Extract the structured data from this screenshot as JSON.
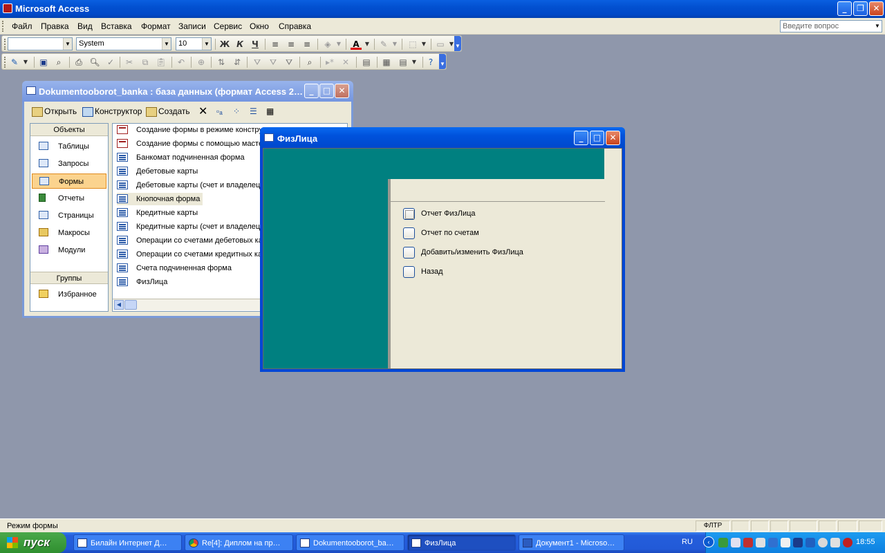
{
  "app": {
    "title": "Microsoft Access"
  },
  "menu": [
    {
      "label": "Файл"
    },
    {
      "label": "Правка"
    },
    {
      "label": "Вид"
    },
    {
      "label": "Вставка"
    },
    {
      "label": "Формат"
    },
    {
      "label": "Записи"
    },
    {
      "label": "Сервис"
    },
    {
      "label": "Окно"
    },
    {
      "label": "Справка"
    }
  ],
  "help_box": {
    "placeholder": "Введите вопрос"
  },
  "format_toolbar": {
    "object_combo": "",
    "font": "System",
    "size": "10"
  },
  "dbwindow": {
    "title": "Dokumentooborot_banka : база данных (формат Access 2…",
    "toolbar": {
      "open": "Открыть",
      "designer": "Конструктор",
      "create": "Создать"
    },
    "objects_header": "Объекты",
    "objects": [
      "Таблицы",
      "Запросы",
      "Формы",
      "Отчеты",
      "Страницы",
      "Макросы",
      "Модули"
    ],
    "selected_object": "Формы",
    "groups_header": "Группы",
    "groups": [
      "Избранное"
    ],
    "items": [
      "Создание формы в режиме конструктора",
      "Создание формы с помощью мастера",
      "Банкомат подчиненная форма",
      "Дебетовые карты",
      "Дебетовые карты (счет и владелец)",
      "Кнопочная форма",
      "Кредитные карты",
      "Кредитные карты (счет и владелец)",
      "Операции со счетами дебетовых карт",
      "Операции со счетами кредитных карт",
      "Счета подчиненная форма",
      "ФизЛица"
    ]
  },
  "form": {
    "title": "ФизЛица",
    "buttons": [
      "Отчет ФизЛица",
      "Отчет по счетам",
      "Добавить/изменить ФизЛица",
      "Назад"
    ]
  },
  "status": {
    "text": "Режим формы",
    "filter": "ФЛТР"
  },
  "taskbar": {
    "start": "пуск",
    "tasks": [
      "Билайн Интернет Д…",
      "Re[4]: Диплом на пр…",
      "Dokumentooborot_ba…",
      "ФизЛица",
      "Документ1 - Microso…"
    ],
    "active": "ФизЛица",
    "lang": "RU",
    "clock": "18:55"
  },
  "colors": {
    "teal": "#008080",
    "xp_blue": "#0054e3",
    "selection": "#fbd38e"
  }
}
